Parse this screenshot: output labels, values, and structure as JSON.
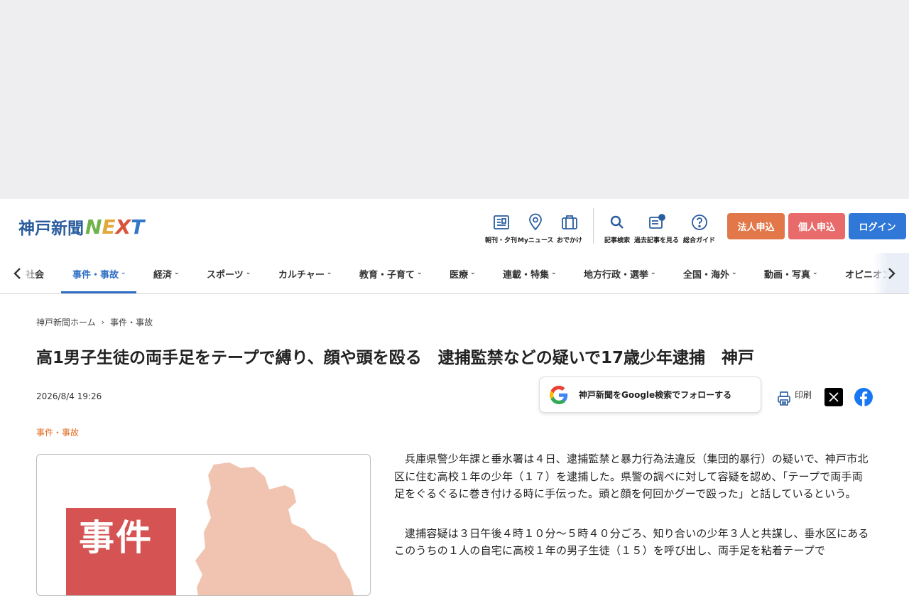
{
  "header": {
    "logo_jp": "神戸新聞",
    "logo_next_n": "N",
    "logo_next_e": "E",
    "logo_next_x": "X",
    "logo_next_t": "T",
    "tools": [
      {
        "label": "朝刊・夕刊",
        "icon": "newspaper-icon"
      },
      {
        "label": "Myニュース",
        "icon": "location-pin-icon"
      },
      {
        "label": "おでかけ",
        "icon": "suitcase-icon"
      },
      {
        "label": "記事検索",
        "icon": "search-icon"
      },
      {
        "label": "過去記事を見る",
        "icon": "archive-icon"
      },
      {
        "label": "総合ガイド",
        "icon": "help-circle-icon"
      }
    ],
    "buttons": {
      "corporate": "法人申込",
      "personal": "個人申込",
      "login": "ログイン"
    },
    "colors": {
      "corporate": "#e2784a",
      "personal": "#e86a6a",
      "login": "#2f78d8"
    }
  },
  "nav": {
    "items": [
      {
        "label": "社会",
        "has_menu": false
      },
      {
        "label": "事件・事故",
        "has_menu": true,
        "active": true
      },
      {
        "label": "経済",
        "has_menu": true
      },
      {
        "label": "スポーツ",
        "has_menu": true
      },
      {
        "label": "カルチャー",
        "has_menu": true
      },
      {
        "label": "教育・子育て",
        "has_menu": true
      },
      {
        "label": "医療",
        "has_menu": true
      },
      {
        "label": "連載・特集",
        "has_menu": true
      },
      {
        "label": "地方行政・選挙",
        "has_menu": true
      },
      {
        "label": "全国・海外",
        "has_menu": true
      },
      {
        "label": "動画・写真",
        "has_menu": true
      },
      {
        "label": "オピニオン",
        "has_menu": true
      }
    ],
    "accent": "#2f6fc6"
  },
  "breadcrumb": {
    "home": "神戸新聞ホーム",
    "separator": "›",
    "current": "事件・事故"
  },
  "article": {
    "title": "高1男子生徒の両手足をテープで縛り、顔や頭を殴る　逮捕監禁などの疑いで17歳少年逮捕　神戸",
    "date": "2026/8/4 19:26",
    "google_follow": "神戸新聞をGoogle検索でフォローする",
    "print_label": "印刷",
    "category": "事件・事故",
    "category_color": "#e26a1e",
    "photo_label": "事件",
    "paragraphs": [
      "兵庫県警少年課と垂水署は４日、逮捕監禁と暴力行為法違反（集団的暴行）の疑いで、神戸市北区に住む高校１年の少年（１７）を逮捕した。県警の調べに対して容疑を認め、「テープで両手両足をぐるぐるに巻き付ける時に手伝った。頭と顔を何回かグーで殴った」と話しているという。",
      "逮捕容疑は３日午後４時１０分～５時４０分ごろ、知り合いの少年３人と共謀し、垂水区にあるこのうちの１人の自宅に高校１年の男子生徒（１５）を呼び出し、両手足を粘着テープで"
    ]
  }
}
